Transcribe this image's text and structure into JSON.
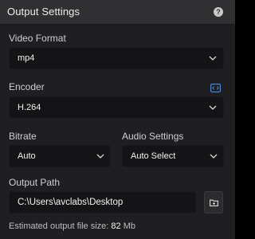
{
  "header": {
    "title": "Output Settings",
    "help_icon": "question-circle-icon",
    "help_glyph": "?"
  },
  "video_format": {
    "label": "Video Format",
    "value": "mp4"
  },
  "encoder": {
    "label": "Encoder",
    "value": "H.264",
    "codec_icon": "code-settings-icon",
    "codec_icon_color": "#4a8fe7"
  },
  "bitrate": {
    "label": "Bitrate",
    "value": "Auto"
  },
  "audio": {
    "label": "Audio Settings",
    "value": "Auto Select"
  },
  "output_path": {
    "label": "Output Path",
    "value": "C:\\Users\\avclabs\\Desktop",
    "browse_icon": "folder-icon"
  },
  "estimate": {
    "prefix": "Estimated output file size:",
    "value": "82",
    "unit": "Mb"
  },
  "colors": {
    "panel_bg": "#1f1f21",
    "header_bg": "#303033",
    "field_bg": "#141416",
    "text": "#e6e6e6"
  }
}
